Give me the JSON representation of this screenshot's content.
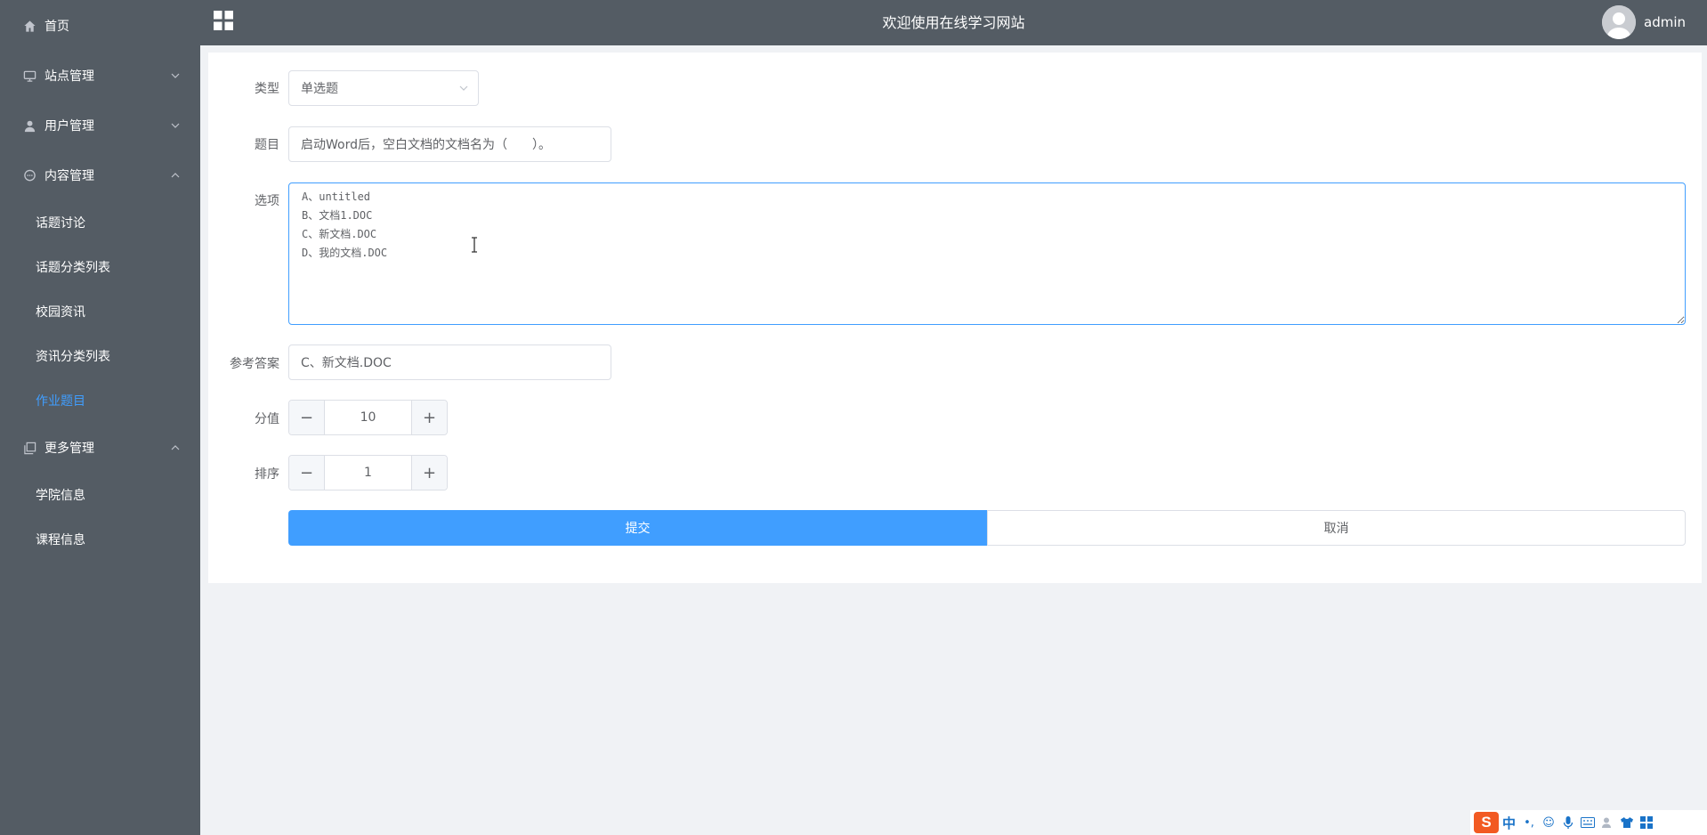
{
  "sidebar": {
    "items": [
      {
        "label": "首页",
        "icon": "home-icon"
      },
      {
        "label": "站点管理",
        "icon": "monitor-icon"
      },
      {
        "label": "用户管理",
        "icon": "user-icon"
      },
      {
        "label": "内容管理",
        "icon": "chat-icon"
      },
      {
        "label": "更多管理",
        "icon": "copy-icon"
      }
    ],
    "content_sub": [
      "话题讨论",
      "话题分类列表",
      "校园资讯",
      "资讯分类列表",
      "作业题目"
    ],
    "more_sub": [
      "学院信息",
      "课程信息"
    ],
    "active_item": "作业题目",
    "active_color": "#409eff"
  },
  "header": {
    "title": "欢迎使用在线学习网站",
    "username": "admin",
    "background": "#545c64"
  },
  "form": {
    "type": {
      "label": "类型",
      "value": "单选题"
    },
    "question": {
      "label": "题目",
      "value": "启动Word后，空白文档的文档名为（　　）。"
    },
    "options": {
      "label": "选项",
      "value": "A、untitled\nB、文档1.DOC\nC、新文档.DOC\nD、我的文档.DOC"
    },
    "answer": {
      "label": "参考答案",
      "value": "C、新文档.DOC"
    },
    "score": {
      "label": "分值",
      "value": "10"
    },
    "order": {
      "label": "排序",
      "value": "1"
    },
    "submit_label": "提交",
    "cancel_label": "取消",
    "primary_color": "#409eff"
  },
  "ime": {
    "mode": "中",
    "icons": [
      "punctuation-icon",
      "emoji-icon",
      "mic-icon",
      "keyboard-icon",
      "user-icon",
      "shirt-icon",
      "grid-icon"
    ]
  }
}
